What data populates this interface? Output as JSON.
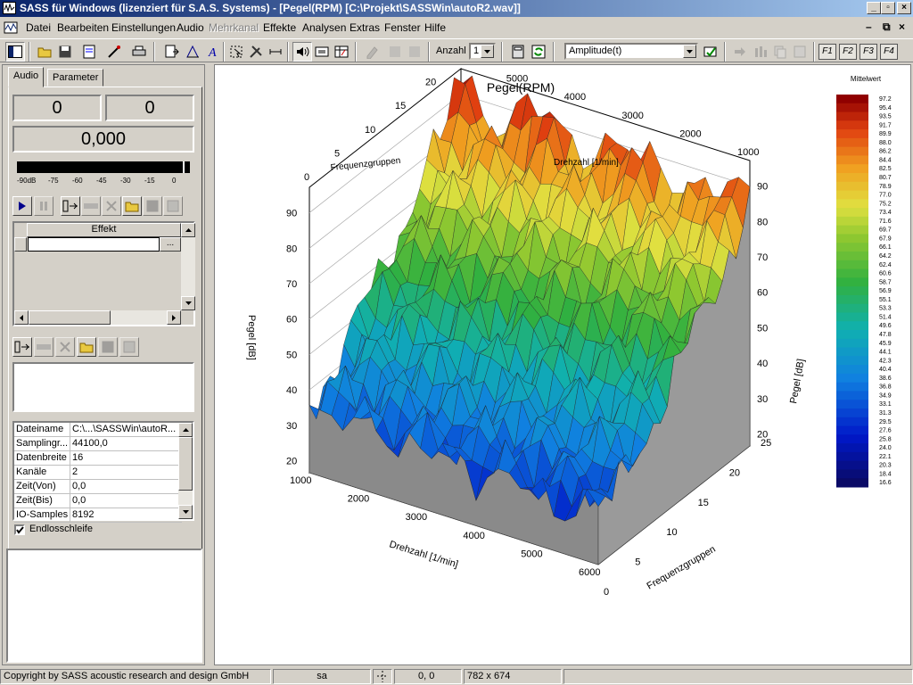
{
  "window": {
    "title": "SASS für Windows (lizenziert für S.A.S. Systems)  - [Pegel(RPM) [C:\\Projekt\\SASSWin\\autoR2.wav]]"
  },
  "menu": {
    "items": [
      "Datei",
      "Bearbeiten",
      "Einstellungen",
      "Audio",
      "Mehrkanal",
      "Effekte",
      "Analysen",
      "Extras",
      "Fenster",
      "Hilfe"
    ]
  },
  "toolbar": {
    "anzahl_label": "Anzahl",
    "anzahl_value": "1",
    "mode_value": "Amplitude(t)",
    "f_keys": [
      "F1",
      "F2",
      "F3",
      "F4"
    ]
  },
  "left": {
    "tabs": [
      "Audio",
      "Parameter"
    ],
    "counter_left": "0",
    "counter_right": "0",
    "time_value": "0,000",
    "meter_labels": [
      "-90dB",
      "-75",
      "-60",
      "-45",
      "-30",
      "-15",
      "0"
    ],
    "effect_header": "Effekt",
    "effect_btn": "...",
    "props": [
      {
        "key": "Dateiname",
        "value": "C:\\...\\SASSWin\\autoR..."
      },
      {
        "key": "Samplingr...",
        "value": "44100,0"
      },
      {
        "key": "Datenbreite",
        "value": "16"
      },
      {
        "key": "Kanäle",
        "value": "2"
      },
      {
        "key": "Zeit(Von)",
        "value": "0,0"
      },
      {
        "key": "Zeit(Bis)",
        "value": "0,0"
      },
      {
        "key": "IO-Samples",
        "value": "8192"
      }
    ],
    "loop_label": "Endlosschleife",
    "loop_checked": true
  },
  "chart_data": {
    "type": "surface3d",
    "title": "Pegel(RPM)",
    "axes": {
      "rpm": {
        "label": "Drehzahl [1/min]",
        "ticks": [
          "6000",
          "5000",
          "4000",
          "3000",
          "2000",
          "1000"
        ],
        "range": [
          1000,
          6000
        ]
      },
      "freq": {
        "label": "Frequenzgruppen",
        "ticks": [
          "0",
          "5",
          "10",
          "15",
          "20",
          "25"
        ],
        "range": [
          0,
          25
        ]
      },
      "level": {
        "label": "Pegel [dB]",
        "ticks": [
          "20",
          "30",
          "40",
          "50",
          "60",
          "70",
          "80",
          "90"
        ],
        "range": [
          16.6,
          97.2
        ]
      }
    },
    "colorbar": {
      "title": "Mittelwert",
      "labels": [
        "97.2",
        "95.4",
        "93.5",
        "91.7",
        "89.9",
        "88.0",
        "86.2",
        "84.4",
        "82.5",
        "80.7",
        "78.9",
        "77.0",
        "75.2",
        "73.4",
        "71.6",
        "69.7",
        "67.9",
        "66.1",
        "64.2",
        "62.4",
        "60.6",
        "58.7",
        "56.9",
        "55.1",
        "53.3",
        "51.4",
        "49.6",
        "47.8",
        "45.9",
        "44.1",
        "42.3",
        "40.4",
        "38.6",
        "36.8",
        "34.9",
        "33.1",
        "31.3",
        "29.5",
        "27.6",
        "25.8",
        "24.0",
        "22.1",
        "20.3",
        "18.4",
        "16.6"
      ]
    }
  },
  "status": {
    "copyright": "Copyright by SASS acoustic research and design GmbH",
    "user": "sa",
    "coords": "0, 0",
    "size": "782 x 674"
  }
}
